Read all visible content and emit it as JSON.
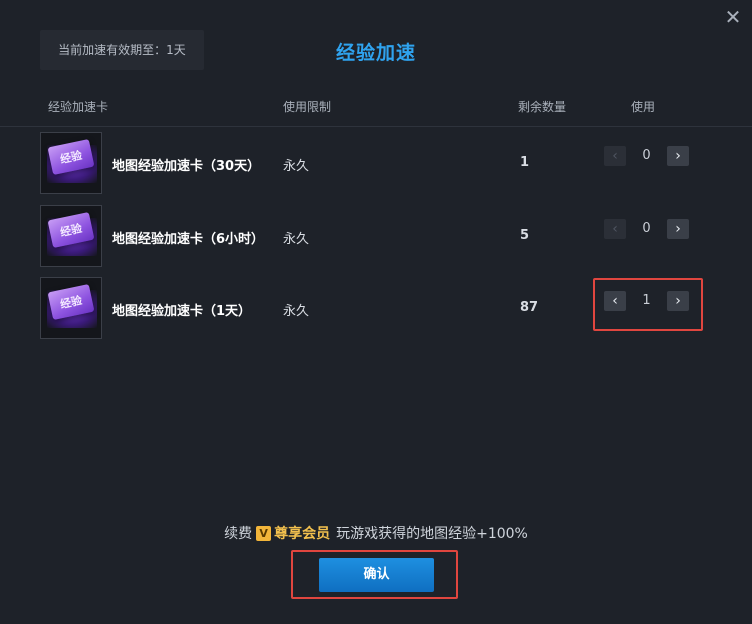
{
  "dialog": {
    "title": "经验加速",
    "validity": "当前加速有效期至：1天",
    "close_icon": "close-icon"
  },
  "headers": {
    "card": "经验加速卡",
    "limit": "使用限制",
    "remaining": "剩余数量",
    "use": "使用"
  },
  "items": [
    {
      "card_label": "经验",
      "name": "地图经验加速卡（30天）",
      "limit": "永久",
      "remaining": "1",
      "use": "0"
    },
    {
      "card_label": "经验",
      "name": "地图经验加速卡（6小时）",
      "limit": "永久",
      "remaining": "5",
      "use": "0"
    },
    {
      "card_label": "经验",
      "name": "地图经验加速卡（1天）",
      "limit": "永久",
      "remaining": "87",
      "use": "1"
    }
  ],
  "stepper_icons": {
    "decrease": "chevron-left-icon",
    "increase": "chevron-right-icon"
  },
  "promo": {
    "prefix": "续费",
    "badge": "V",
    "vip": "尊享会员",
    "text": "玩游戏获得的地图经验+100%"
  },
  "confirm_label": "确认",
  "colors": {
    "background": "#1e2229",
    "title": "#2fa3ef",
    "vip": "#f2c04e",
    "confirm": "#1a85d8",
    "highlight": "#e0463f"
  }
}
